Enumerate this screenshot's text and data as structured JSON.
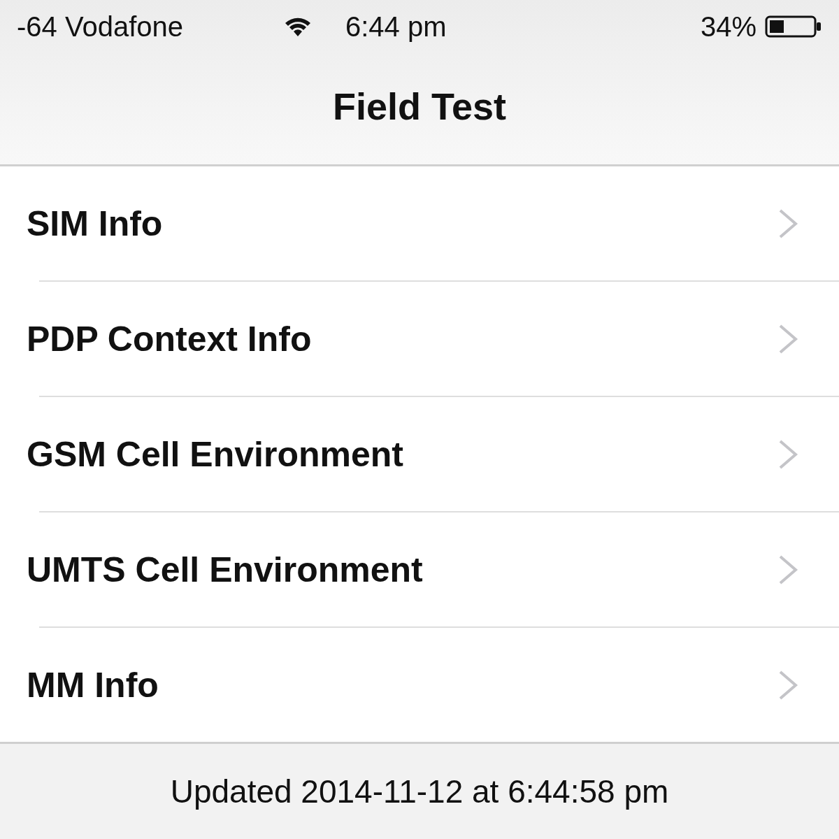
{
  "status_bar": {
    "carrier": "-64 Vodafone",
    "time": "6:44 pm",
    "battery": "34%"
  },
  "nav_bar": {
    "title": "Field Test"
  },
  "items": [
    {
      "label": "SIM Info"
    },
    {
      "label": "PDP Context Info"
    },
    {
      "label": "GSM Cell Environment"
    },
    {
      "label": "UMTS Cell Environment"
    },
    {
      "label": "MM Info"
    }
  ],
  "footer": {
    "text": "Updated 2014-11-12 at 6:44:58 pm"
  }
}
